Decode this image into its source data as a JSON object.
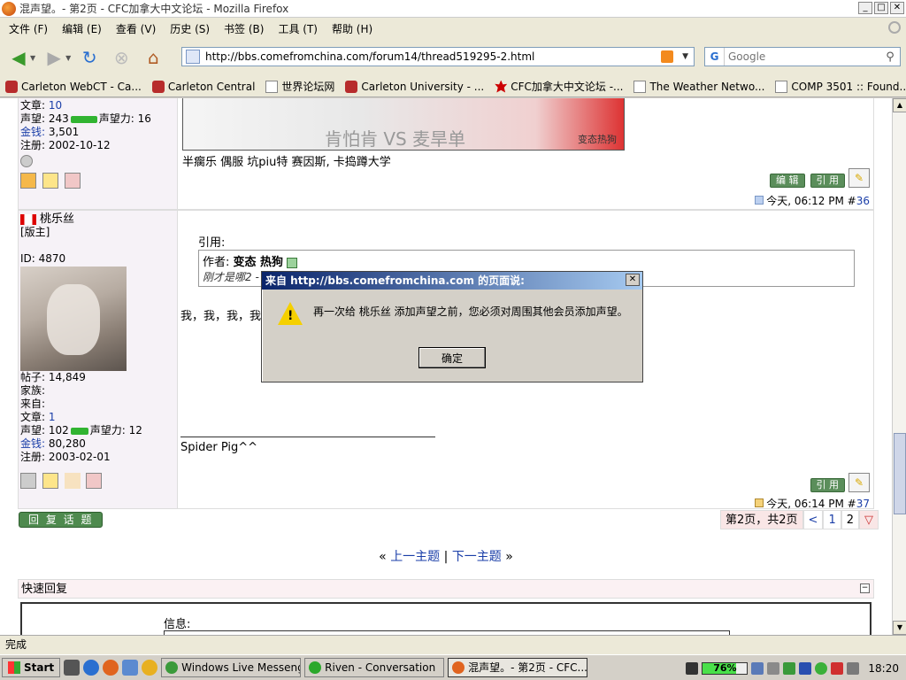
{
  "window": {
    "title": "混声望。- 第2页 - CFC加拿大中文论坛 - Mozilla Firefox"
  },
  "menu": [
    "文件 (F)",
    "编辑 (E)",
    "查看 (V)",
    "历史 (S)",
    "书签 (B)",
    "工具 (T)",
    "帮助 (H)"
  ],
  "nav": {
    "url": "http://bbs.comefromchina.com/forum14/thread519295-2.html",
    "search_placeholder": "Google"
  },
  "bookmarks": [
    "Carleton WebCT - Ca...",
    "Carleton Central",
    "世界论坛网",
    "Carleton University - ...",
    "CFC加拿大中文论坛 -...",
    "The Weather Netwo...",
    "COMP 3501 :: Found..."
  ],
  "post1": {
    "stats": [
      {
        "label": "文章: ",
        "value": "10"
      },
      {
        "label": "声望: ",
        "value": "243",
        "extra_label": "声望力: ",
        "extra": "16"
      },
      {
        "label": "金钱: ",
        "value": "3,501"
      },
      {
        "label": "注册: ",
        "value": "2002-10-12"
      }
    ],
    "banner_text": "肯怕肯 VS 麦旱单",
    "banner_sub": "变态热狗",
    "signature": "半瘸乐 偶服 坑piu特 赛因斯, 卡捣蹲大学",
    "edit_btn": "编 辑",
    "quote_btn": "引 用",
    "time": "今天, 06:12 PM #",
    "num": "36"
  },
  "post2": {
    "username": "桃乐丝",
    "role": "[版主]",
    "id_text": "ID: 4870",
    "stats": [
      {
        "label": "帖子: ",
        "value": "14,849"
      },
      {
        "label": "家族: ",
        "value": ""
      },
      {
        "label": "来自: ",
        "value": ""
      },
      {
        "label": "文章: ",
        "value": "1"
      },
      {
        "label": "声望: ",
        "value": "102",
        "extra_label": "声望力: ",
        "extra": "12"
      },
      {
        "label": "金钱: ",
        "value": "80,280"
      },
      {
        "label": "注册: ",
        "value": "2003-02-01"
      }
    ],
    "quote_label": "引用:",
    "quote_author_prefix": "作者: ",
    "quote_author": "变态 热狗",
    "quote_text": "刚才是哪2 -",
    "body_text": "我，我，我，我",
    "signature": "Spider Pig^^",
    "quote_btn": "引 用",
    "time": "今天, 06:14 PM #",
    "num": "37"
  },
  "reply_button": "回 复 话 题",
  "pagination": {
    "info": "第2页，共2页",
    "prev": "<",
    "pages": [
      "1",
      "2"
    ],
    "menu": "▽"
  },
  "thread_nav": {
    "open": "« ",
    "prev": "上一主题",
    "sep": " | ",
    "next": "下一主题",
    "close": " »"
  },
  "quick_reply": {
    "title": "快速回复",
    "info_label": "信息:"
  },
  "dialog": {
    "title": "来自 http://bbs.comefromchina.com 的页面说:",
    "message": "再一次给 桃乐丝 添加声望之前，您必须对周围其他会员添加声望。",
    "ok": "确定"
  },
  "status": "完成",
  "taskbar": {
    "start": "Start",
    "tasks": [
      "Windows Live Messenger",
      "Riven - Conversation",
      "混声望。- 第2页 - CFC..."
    ],
    "battery": "76%",
    "clock": "18:20"
  },
  "colors": {
    "link": "#1a3ea8",
    "title_bar": "#0a246a",
    "post_side_bg": "#f6f2f7",
    "pagebar_bg": "#f9e6e6"
  }
}
